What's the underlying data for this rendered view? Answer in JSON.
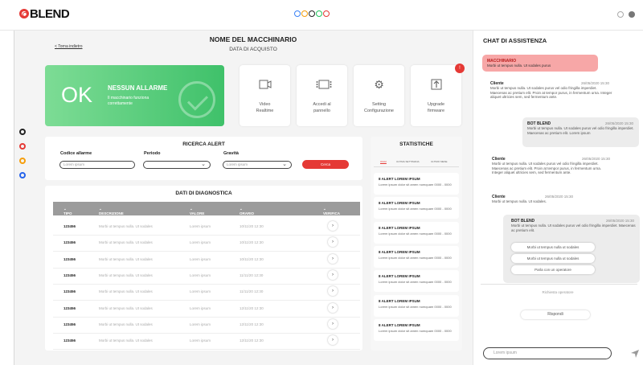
{
  "header": {
    "logo": "BLEND"
  },
  "main": {
    "back_link": "< Torna indietro",
    "machine_name": "NOME DEL MACCHINARIO",
    "purchase_date": "DATA DI ACQUISTO"
  },
  "status": {
    "ok": "OK",
    "title": "NESSUN ALLARME",
    "subtitle": "Il macchinario funziona correttamente"
  },
  "actions": [
    {
      "label": "Video\nRealtime",
      "icon": "video-icon"
    },
    {
      "label": "Accedi al\npannello",
      "icon": "panel-icon"
    },
    {
      "label": "Setting\nConfigurazione",
      "icon": "gear-icon"
    },
    {
      "label": "Upgrade\nfirmware",
      "icon": "upload-icon"
    }
  ],
  "notification_badge": "!",
  "alert_search": {
    "title": "RICERCA ALERT",
    "code_label": "Codice allarme",
    "code_placeholder": "Lorem ipsum",
    "period_label": "Periodo",
    "severity_label": "Gravità",
    "severity_value": "Lorem ipsum",
    "search_button": "Cerca"
  },
  "diagnostics": {
    "title": "DATI DI DIAGNOSTICA",
    "columns": [
      "TIPO",
      "DESCRIZIONE",
      "VALORE",
      "ORARIO",
      "VERIFICA"
    ],
    "rows": [
      {
        "tipo": "123456",
        "descrizione": "Morbi ut tempus nulla. Ut sodales",
        "valore": "Lorem ipsum",
        "orario": "10/11/20 12:30"
      },
      {
        "tipo": "123456",
        "descrizione": "Morbi ut tempus nulla. Ut sodales",
        "valore": "Lorem ipsum",
        "orario": "10/11/20 12:30"
      },
      {
        "tipo": "123456",
        "descrizione": "Morbi ut tempus nulla. Ut sodales",
        "valore": "Lorem ipsum",
        "orario": "10/11/20 12:30"
      },
      {
        "tipo": "123456",
        "descrizione": "Morbi ut tempus nulla. Ut sodales",
        "valore": "Lorem ipsum",
        "orario": "11/11/20 12:30"
      },
      {
        "tipo": "123456",
        "descrizione": "Morbi ut tempus nulla. Ut sodales",
        "valore": "Lorem ipsum",
        "orario": "11/11/20 12:30"
      },
      {
        "tipo": "123456",
        "descrizione": "Morbi ut tempus nulla. Ut sodales",
        "valore": "Lorem ipsum",
        "orario": "12/11/20 12:30"
      },
      {
        "tipo": "123456",
        "descrizione": "Morbi ut tempus nulla. Ut sodales",
        "valore": "Lorem ipsum",
        "orario": "12/11/20 12:30"
      },
      {
        "tipo": "123456",
        "descrizione": "Morbi ut tempus nulla. Ut sodales",
        "valore": "Lorem ipsum",
        "orario": "12/11/20 12:30"
      }
    ]
  },
  "stats": {
    "title": "STATISTICHE",
    "tabs": [
      "OGGI",
      "ULTIMA SETTIMANA",
      "ULTIMO MESE"
    ],
    "alerts": [
      {
        "title": "8 ALERT LOREM IPSUM",
        "body": "Lorem ipsum dolor sit amen numquam 0000 - 0000"
      },
      {
        "title": "8 ALERT LOREM IPSUM",
        "body": "Lorem ipsum dolor sit amen numquam 0000 - 0000"
      },
      {
        "title": "8 ALERT LOREM IPSUM",
        "body": "Lorem ipsum dolor sit amen numquam 0000 - 0000"
      },
      {
        "title": "8 ALERT LOREM IPSUM",
        "body": "Lorem ipsum dolor sit amen numquam 0000 - 0000"
      },
      {
        "title": "8 ALERT LOREM IPSUM",
        "body": "Lorem ipsum dolor sit amen numquam 0000 - 0000"
      },
      {
        "title": "8 ALERT LOREM IPSUM",
        "body": "Lorem ipsum dolor sit amen numquam 0000 - 0000"
      },
      {
        "title": "8 ALERT LOREM IPSUM",
        "body": "Lorem ipsum dolor sit amen numquam 0000 - 0000"
      }
    ]
  },
  "chat": {
    "title": "CHAT DI ASSISTENZA",
    "messages": [
      {
        "sender": "MACCHINARIO",
        "text": "Morbi ut tempus nulla. Ut sodales purus"
      },
      {
        "sender": "Cliente",
        "date": "26/05/2020 15:30",
        "text": "Morbi ut tempus nulla. Ut sodales purus vel odio fringilla imperdiet. Maecenas ac pretium elit. Proin at tempor purus, in fermentum urna. Integer aliquet ultricies sem, sed fermentum ante."
      },
      {
        "sender": "BOT BLEND",
        "date": "26/05/2020 15:30",
        "text": "Morbi ut tempus nulla. Ut sodales purus vel odio fringilla imperdiet. Maecenas ac pretium elit. Lorem ipsum"
      },
      {
        "sender": "Cliente",
        "date": "26/05/2020 15:30",
        "text": "Morbi ut tempus nulla. Ut sodales purus vel odio fringilla imperdiet. Maecenas ac pretium elit. Proin at tempor purus, in fermentum urna. Integer aliquet ultricies sem, sed fermentum ante."
      },
      {
        "sender": "Cliente",
        "date": "26/05/2020 15:30",
        "text": "Morbi ut tempus nulla. Ut sodales."
      },
      {
        "sender": "BOT BLEND",
        "date": "26/05/2020 15:30",
        "text": "Morbi ut tempus nulla. Ut sodales purus vel odio fringilla imperdiet. Maecenas ac pretium elit."
      }
    ],
    "options": [
      "Morbi ut tempus nulla ut sodales",
      "Morbi ut tempus nulla ut sodales",
      "Parla con un operatore"
    ],
    "request_operator": "Richiesta operatore",
    "reply_button": "Rispondi",
    "input_placeholder": "Lorem ipsum"
  },
  "colors": {
    "accent": "#e53935",
    "ok_green": "#3fc16a",
    "machine_bubble": "#f7a7a7",
    "bot_bubble": "#ececec"
  }
}
